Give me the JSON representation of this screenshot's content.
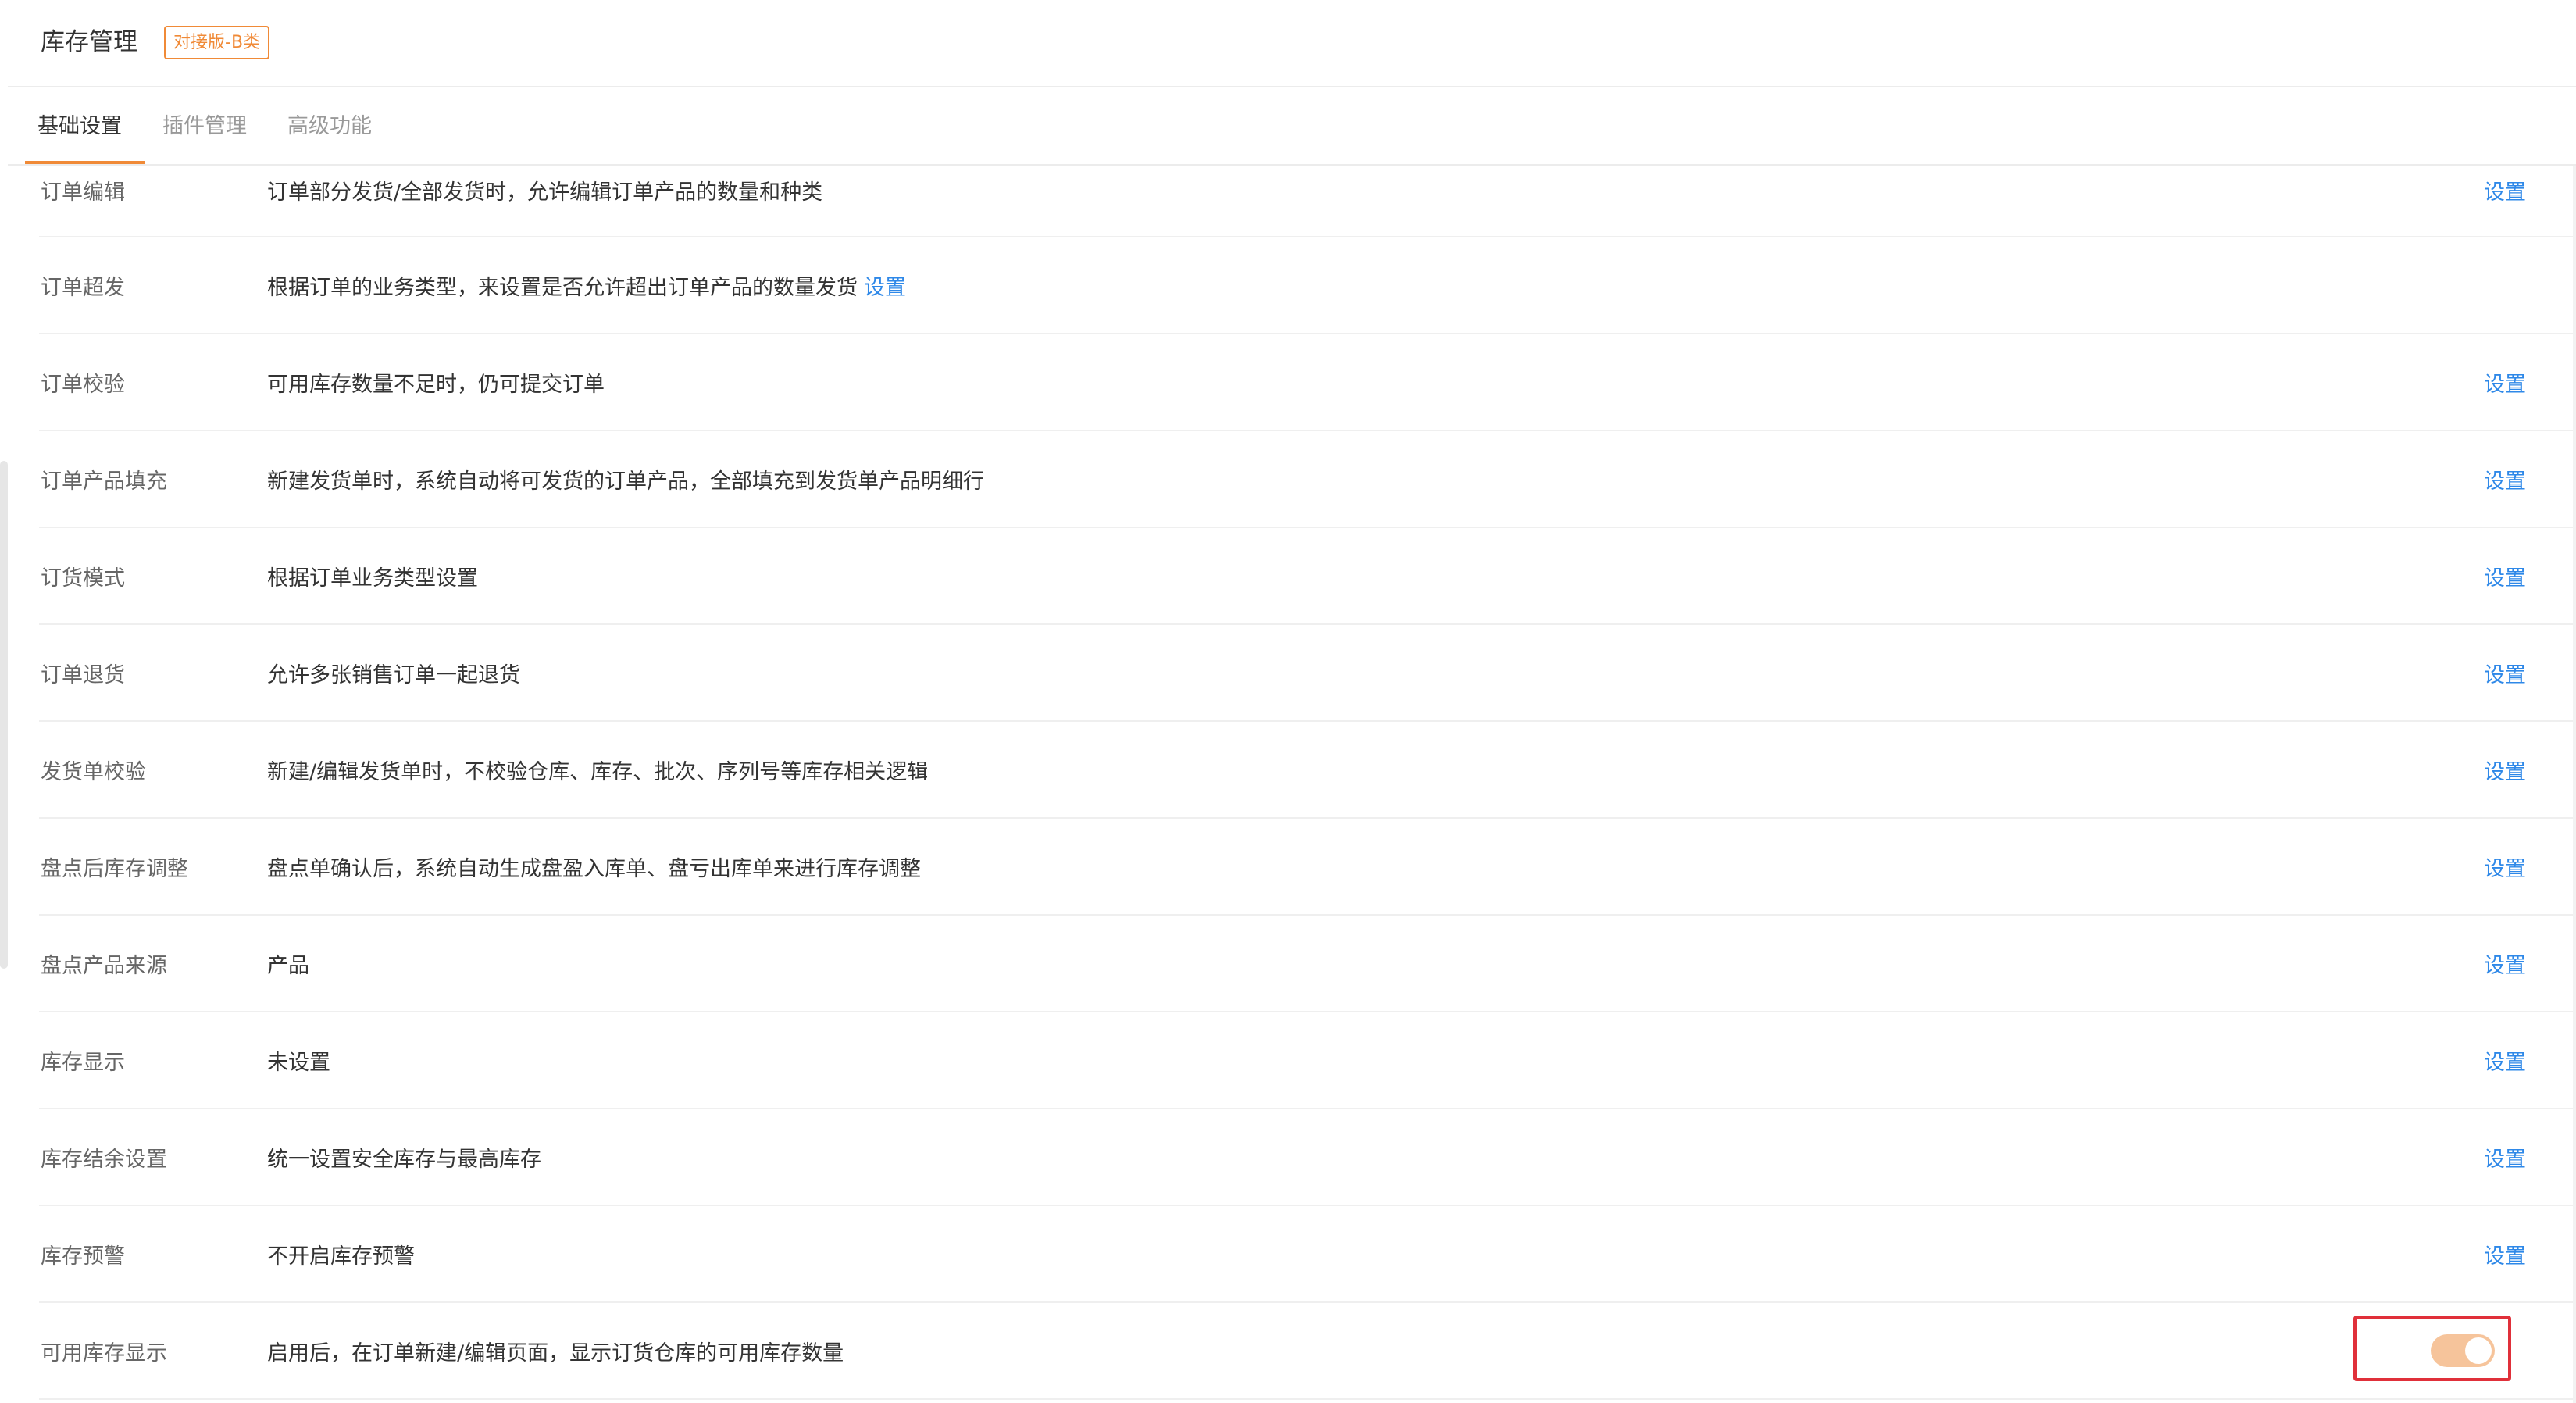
{
  "header": {
    "title": "库存管理",
    "badge": "对接版-B类"
  },
  "tabs": [
    {
      "label": "基础设置",
      "active": true
    },
    {
      "label": "插件管理",
      "active": false
    },
    {
      "label": "高级功能",
      "active": false
    }
  ],
  "colors": {
    "accent": "#f08a37",
    "link": "#2e88e8",
    "toggle_on": "#f6c49b",
    "highlight_box": "#e0303a"
  },
  "rows": [
    {
      "label": "订单编辑",
      "desc": "订单部分发货/全部发货时，允许编辑订单产品的数量和种类",
      "action": "设置"
    },
    {
      "label": "订单超发",
      "desc": "根据订单的业务类型，来设置是否允许超出订单产品的数量发货",
      "inline_action": "设置"
    },
    {
      "label": "订单校验",
      "desc": "可用库存数量不足时，仍可提交订单",
      "action": "设置"
    },
    {
      "label": "订单产品填充",
      "desc": "新建发货单时，系统自动将可发货的订单产品，全部填充到发货单产品明细行",
      "action": "设置"
    },
    {
      "label": "订货模式",
      "desc": "根据订单业务类型设置",
      "action": "设置"
    },
    {
      "label": "订单退货",
      "desc": "允许多张销售订单一起退货",
      "action": "设置"
    },
    {
      "label": "发货单校验",
      "desc": "新建/编辑发货单时，不校验仓库、库存、批次、序列号等库存相关逻辑",
      "action": "设置"
    },
    {
      "label": "盘点后库存调整",
      "desc": "盘点单确认后，系统自动生成盘盈入库单、盘亏出库单来进行库存调整",
      "action": "设置"
    },
    {
      "label": "盘点产品来源",
      "desc": "产品",
      "action": "设置"
    },
    {
      "label": "库存显示",
      "desc": "未设置",
      "action": "设置"
    },
    {
      "label": "库存结余设置",
      "desc": "统一设置安全库存与最高库存",
      "action": "设置"
    },
    {
      "label": "库存预警",
      "desc": "不开启库存预警",
      "action": "设置"
    },
    {
      "label": "可用库存显示",
      "desc": "启用后，在订单新建/编辑页面，显示订货仓库的可用库存数量",
      "toggle": true
    }
  ]
}
